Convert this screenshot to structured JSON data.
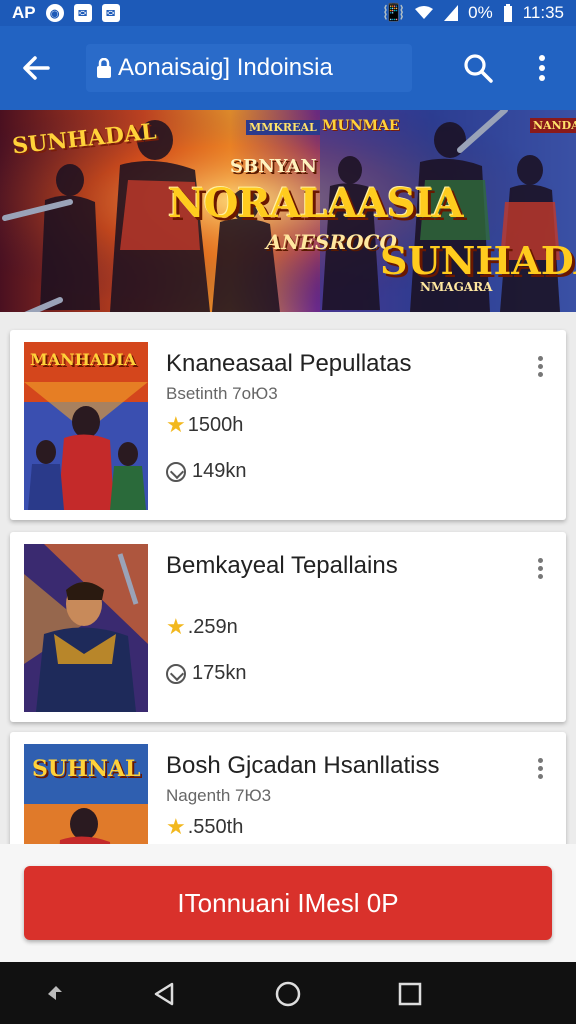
{
  "status_bar": {
    "carrier": "AP",
    "battery": "0%",
    "time": "11:35"
  },
  "app_bar": {
    "title": "Aonaisaig] Indoinsia",
    "icons": [
      "back-arrow-icon",
      "lock-icon",
      "search-icon",
      "more-vert-icon"
    ]
  },
  "banner": {
    "texts": [
      "SUNHADAL",
      "MMKREAL",
      "MUNMAE",
      "NANDATE",
      "SBNYAN",
      "NORALAASIA",
      "ANESROCO",
      "SUNHADA",
      "NMAGARA"
    ]
  },
  "list": {
    "items": [
      {
        "title": "Knaneasaal Pepullatas",
        "subtitle": "Bsetinth 7оЮ3",
        "rating": "1500h",
        "downloads": "149kn",
        "thumb_text": "MANHADIA"
      },
      {
        "title": "Bemkayeal Tepallains",
        "subtitle": "",
        "rating": ".259n",
        "downloads": "175kn",
        "thumb_text": ""
      },
      {
        "title": "Bosh Gjcadan Hsanllatiss",
        "subtitle": "Nagenth 7Ю3",
        "rating": ".550th",
        "downloads": "",
        "thumb_text": "SUHNAL"
      }
    ]
  },
  "action_button": {
    "label": "ITonnuani IMesl 0P"
  },
  "colors": {
    "app_bar": "#2263c2",
    "status_bar": "#1d5ab8",
    "action": "#d9312b",
    "star": "#f2b81e"
  }
}
